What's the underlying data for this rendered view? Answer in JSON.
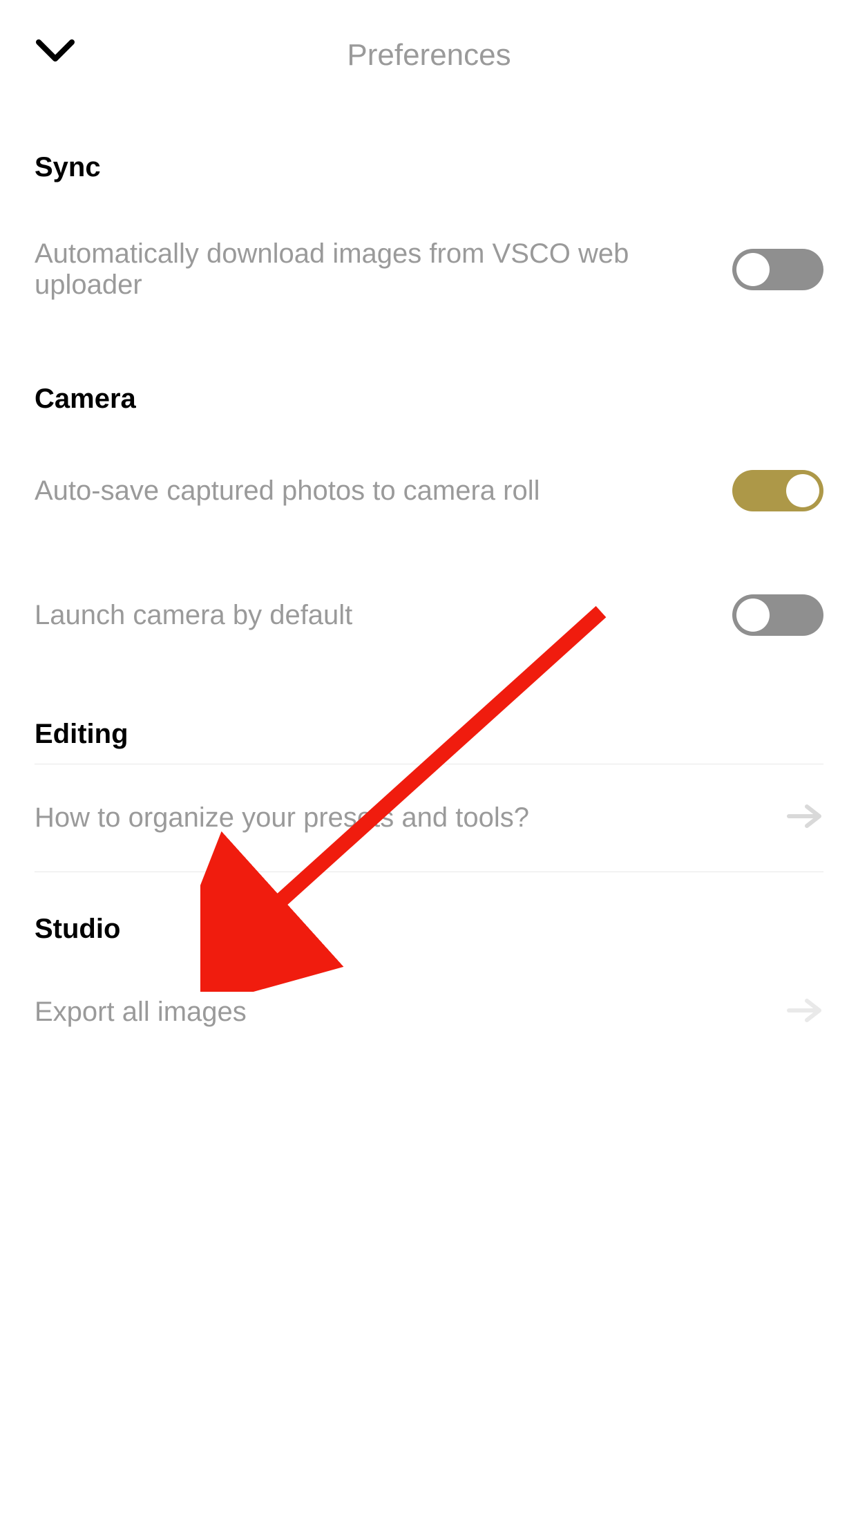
{
  "header": {
    "title": "Preferences"
  },
  "sections": {
    "sync": {
      "title": "Sync",
      "items": {
        "auto_download": {
          "label": "Automatically download images from VSCO web uploader",
          "on": false
        }
      }
    },
    "camera": {
      "title": "Camera",
      "items": {
        "auto_save": {
          "label": "Auto-save captured photos to camera roll",
          "on": true
        },
        "launch_default": {
          "label": "Launch camera by default",
          "on": false
        }
      }
    },
    "editing": {
      "title": "Editing",
      "items": {
        "organize": {
          "label": "How to organize your presets and tools?"
        }
      }
    },
    "studio": {
      "title": "Studio",
      "items": {
        "export_all": {
          "label": "Export all images"
        }
      }
    }
  },
  "annotation": {
    "arrow_color": "#f01c0e"
  }
}
